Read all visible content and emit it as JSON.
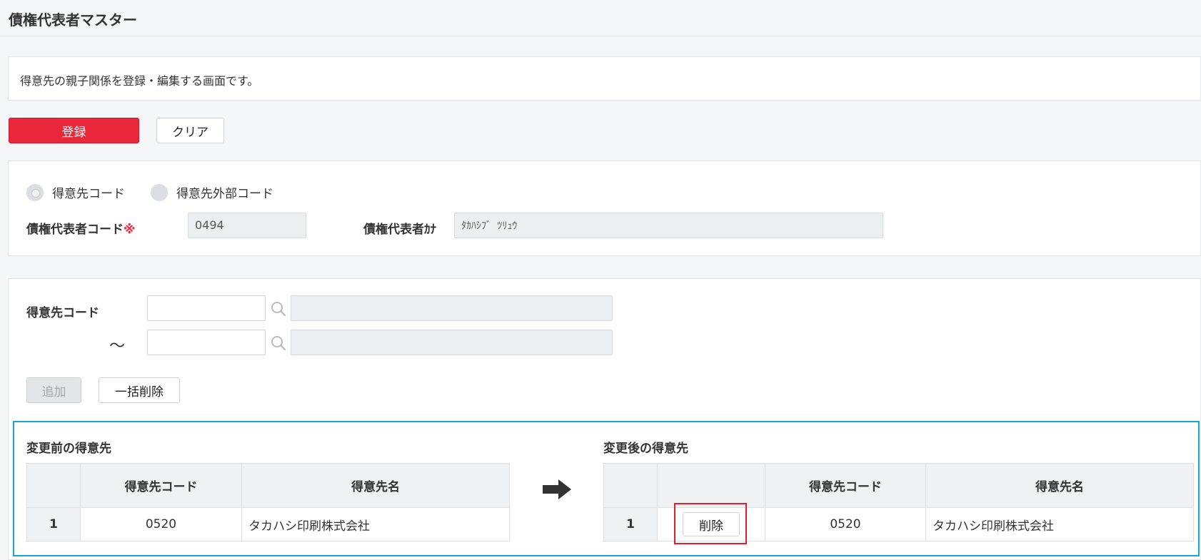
{
  "page": {
    "title": "債権代表者マスター",
    "description": "得意先の親子関係を登録・編集する画面です。"
  },
  "toolbar": {
    "register_label": "登録",
    "clear_label": "クリア"
  },
  "form": {
    "radio_customer_code": "得意先コード",
    "radio_external_code": "得意先外部コード",
    "rep_code_label": "債権代表者コード",
    "required_mark": "※",
    "rep_code_value": "0494",
    "rep_kana_label": "債権代表者ｶﾅ",
    "rep_kana_value": "ﾀｶﾊｼﾌﾞ ﾂﾘｭｳ"
  },
  "search": {
    "customer_code_label": "得意先コード",
    "tilde": "～",
    "add_label": "追加",
    "bulk_delete_label": "一括削除"
  },
  "before": {
    "title": "変更前の得意先",
    "columns": [
      "",
      "得意先コード",
      "得意先名"
    ],
    "rows": [
      {
        "no": "1",
        "code": "0520",
        "name": "タカハシ印刷株式会社"
      }
    ]
  },
  "after": {
    "title": "変更後の得意先",
    "columns": [
      "",
      "",
      "得意先コード",
      "得意先名"
    ],
    "rows": [
      {
        "no": "1",
        "delete_label": "削除",
        "code": "0520",
        "name": "タカハシ印刷株式会社"
      }
    ]
  },
  "colors": {
    "primary": "#e8283a",
    "highlight_border": "#1aa3dc",
    "delete_highlight": "#e31d2b"
  }
}
